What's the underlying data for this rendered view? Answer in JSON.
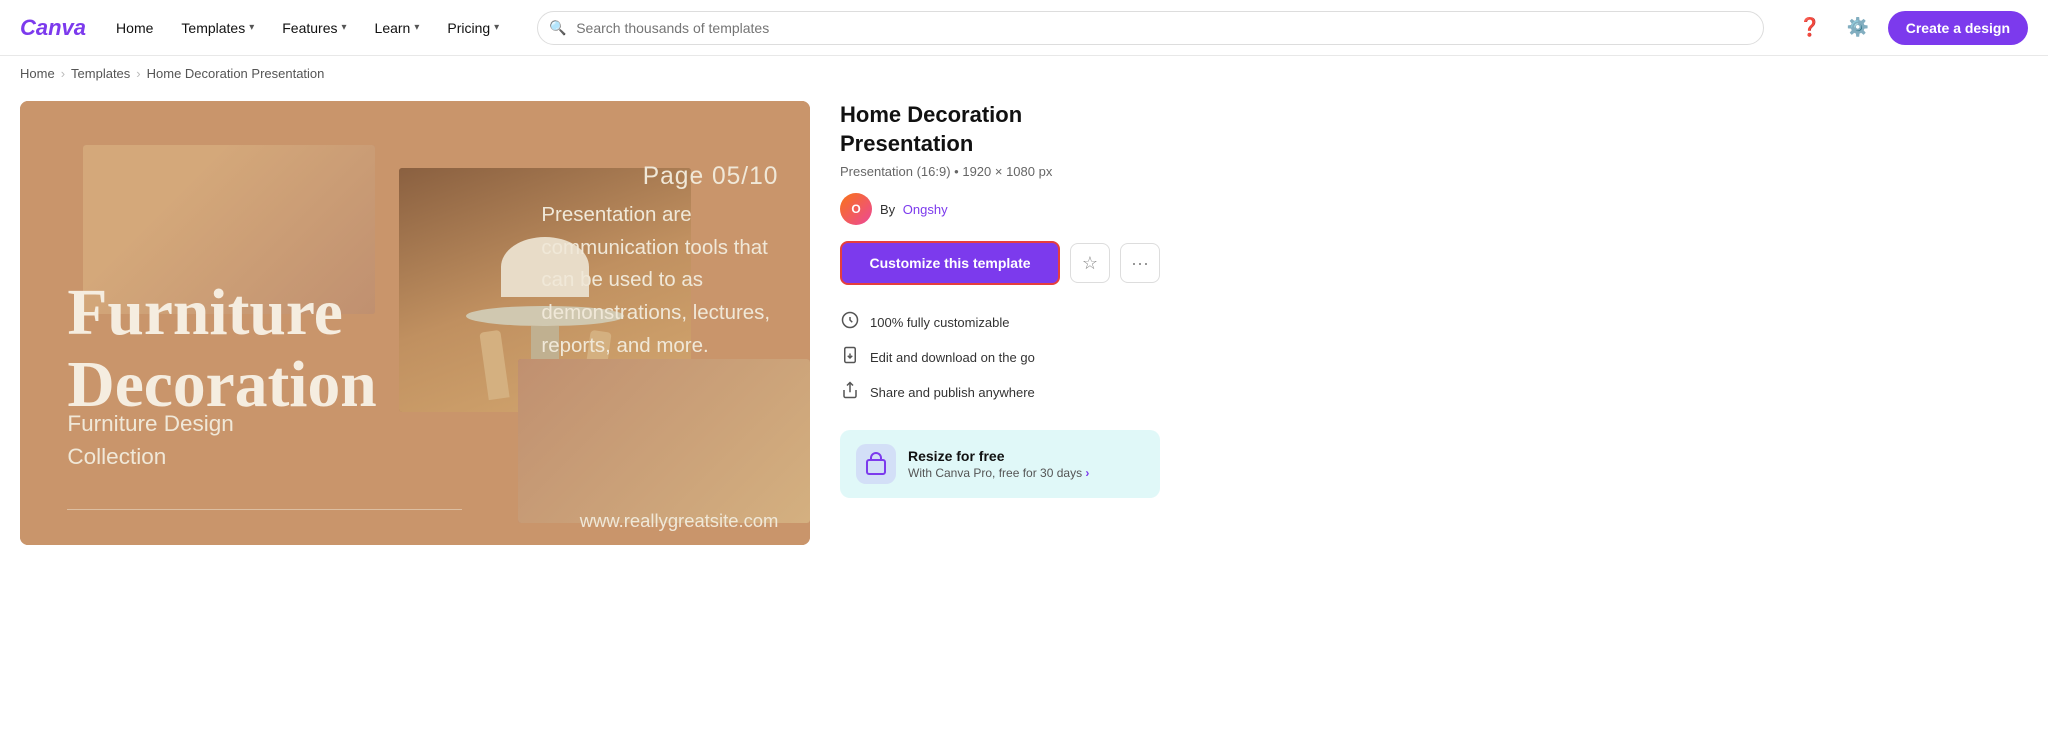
{
  "brand": {
    "logo_text": "Canva"
  },
  "navbar": {
    "home_label": "Home",
    "templates_label": "Templates",
    "features_label": "Features",
    "learn_label": "Learn",
    "pricing_label": "Pricing",
    "search_placeholder": "Search thousands of templates",
    "create_btn": "Create a design"
  },
  "breadcrumb": {
    "home": "Home",
    "templates": "Templates",
    "current": "Home Decoration Presentation"
  },
  "slide": {
    "page_label": "Page 05/10",
    "main_title_line1": "Furniture",
    "main_title_line2": "Decoration",
    "subtitle_line1": "Furniture Design",
    "subtitle_line2": "Collection",
    "description": "Presentation are communication tools that can be used to as demonstrations, lectures, reports, and more.",
    "url": "www.reallygreatsite.com"
  },
  "sidebar": {
    "title": "Home Decoration Presentation",
    "meta": "Presentation (16:9) • 1920 × 1080 px",
    "author_by": "By",
    "author_name": "Ongshy",
    "customize_btn": "Customize this template",
    "star_icon": "☆",
    "more_icon": "•••",
    "features": [
      {
        "icon": "↻",
        "label": "100% fully customizable"
      },
      {
        "icon": "📱",
        "label": "Edit and download on the go"
      },
      {
        "icon": "↑",
        "label": "Share and publish anywhere"
      }
    ],
    "pro_box": {
      "title": "Resize for free",
      "description": "With Canva Pro, free for 30 days",
      "link_arrow": "›"
    }
  }
}
